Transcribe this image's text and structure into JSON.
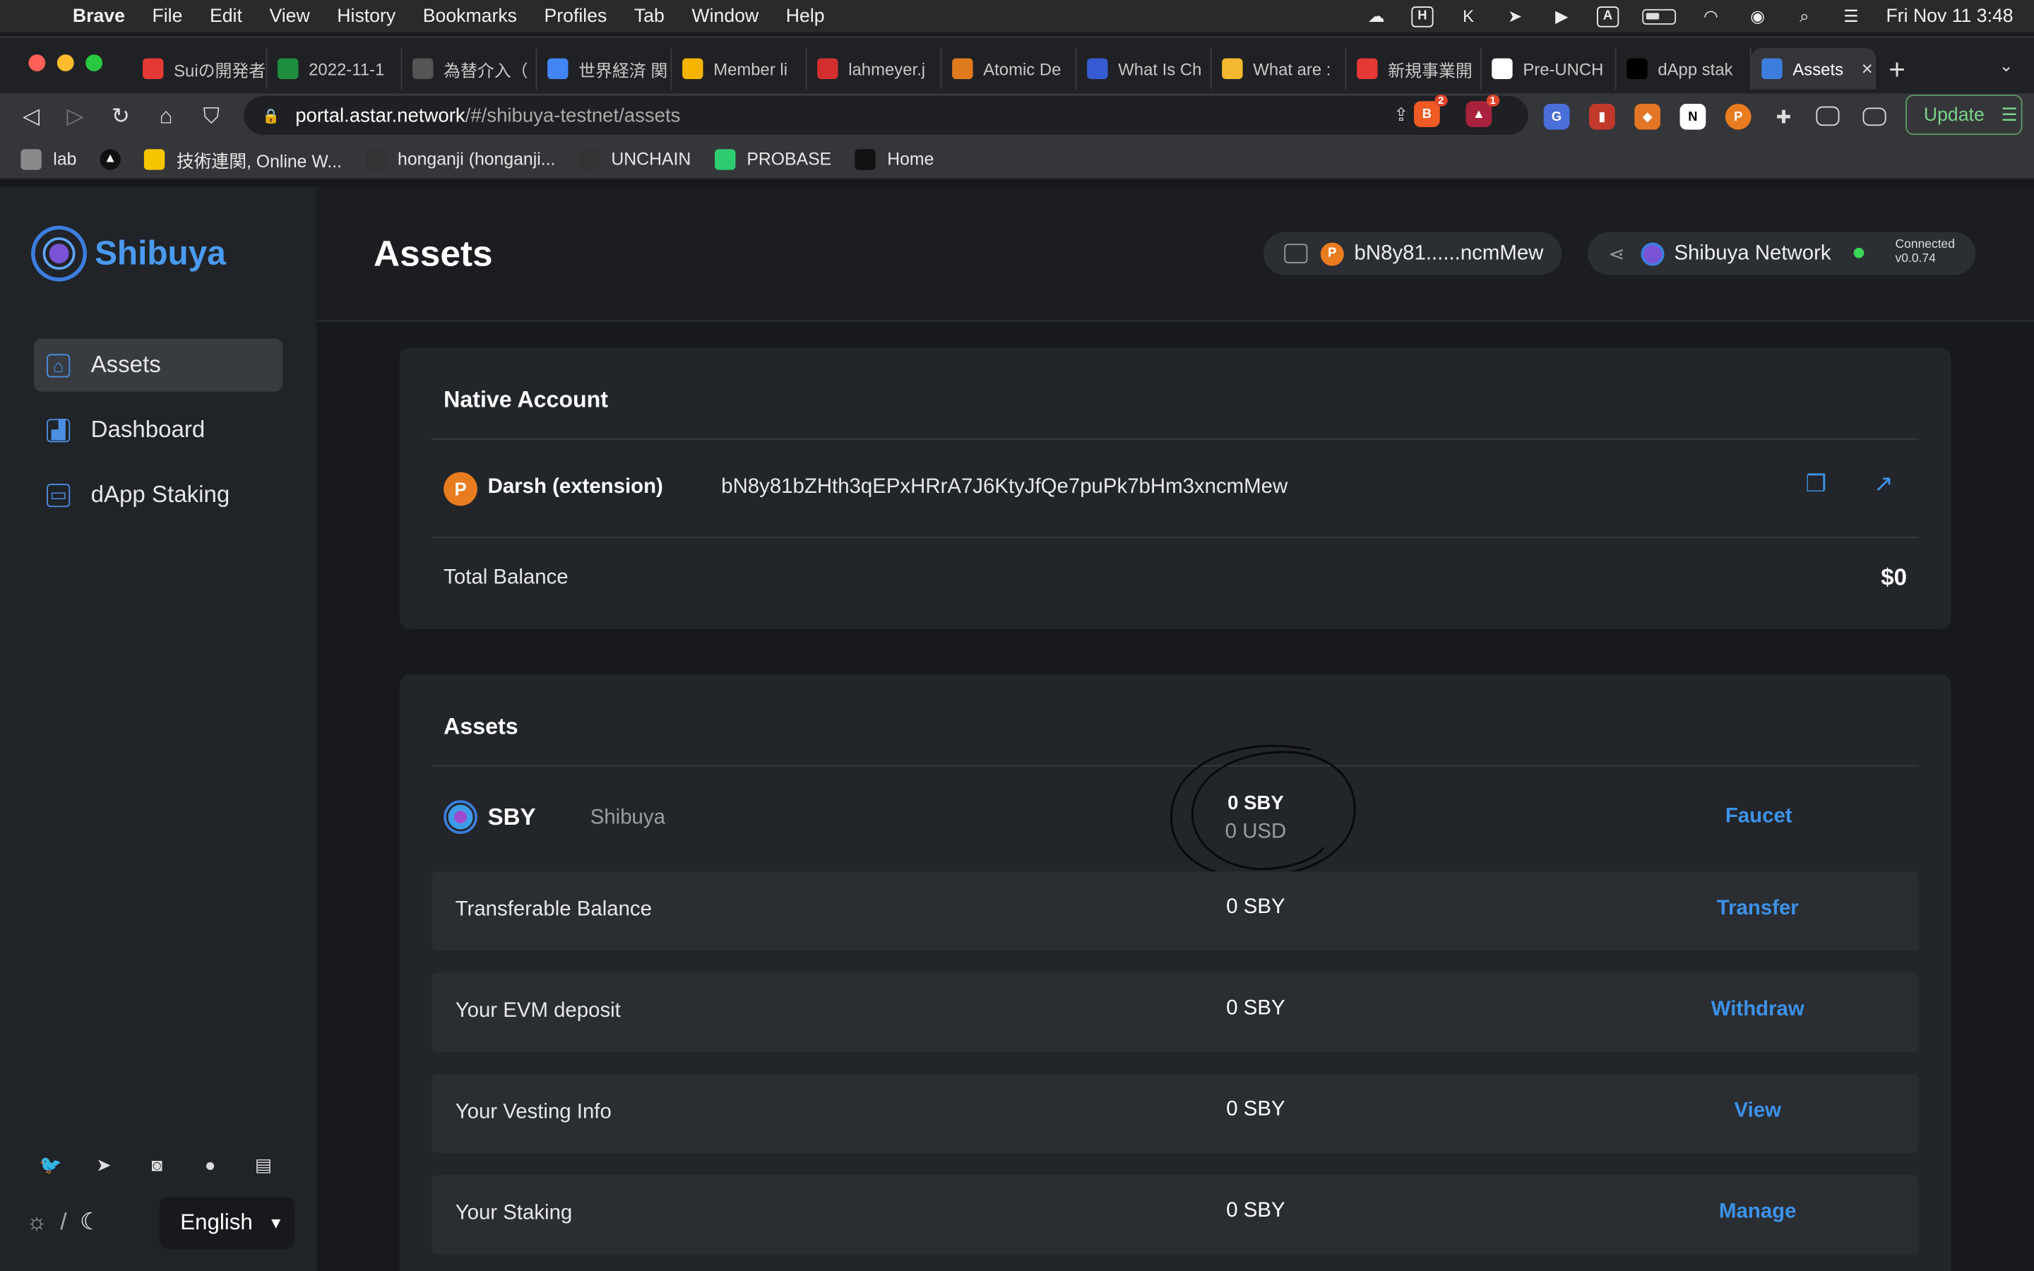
{
  "menubar": {
    "app": "Brave",
    "items": [
      "File",
      "Edit",
      "View",
      "History",
      "Bookmarks",
      "Profiles",
      "Tab",
      "Window",
      "Help"
    ],
    "clock": "Fri Nov 11  3:48"
  },
  "tabs": [
    {
      "label": "Suiの開発者",
      "icon_color": "#e53935"
    },
    {
      "label": "2022-11-1",
      "icon_color": "#1e8e3e"
    },
    {
      "label": "為替介入（",
      "icon_color": "#555555"
    },
    {
      "label": "世界経済 関",
      "icon_color": "#4285f4"
    },
    {
      "label": "Member li",
      "icon_color": "#f4b400"
    },
    {
      "label": "lahmeyer.j",
      "icon_color": "#d32f2f"
    },
    {
      "label": "Atomic De",
      "icon_color": "#e07a1f"
    },
    {
      "label": "What Is Ch",
      "icon_color": "#375bd2"
    },
    {
      "label": "What are :",
      "icon_color": "#f3ba2f"
    },
    {
      "label": "新規事業開",
      "icon_color": "#e53935"
    },
    {
      "label": "Pre-UNCH",
      "icon_color": "#ffffff"
    },
    {
      "label": "dApp stak",
      "icon_color": "#000000"
    },
    {
      "label": "Assets",
      "icon_color": "#3c7ede",
      "active": true
    }
  ],
  "address_bar": {
    "host": "portal.astar.network",
    "path": "/#/shibuya-testnet/assets"
  },
  "toolbar": {
    "update_label": "Update",
    "brave_badge": "2",
    "rewards_badge": "1"
  },
  "bookmarks": [
    {
      "label": "lab",
      "icon": "folder-icon"
    },
    {
      "label": "",
      "icon": "triangle-icon"
    },
    {
      "label": "技術連関, Online W...",
      "icon": "miro-icon"
    },
    {
      "label": "honganji (honganji...",
      "icon": "github-icon"
    },
    {
      "label": "UNCHAIN",
      "icon": "github-icon"
    },
    {
      "label": "PROBASE",
      "icon": "probase-icon"
    },
    {
      "label": "Home",
      "icon": "home-icon"
    }
  ],
  "sidebar": {
    "brand": "Shibuya",
    "items": [
      {
        "label": "Assets",
        "icon": "bank-icon",
        "active": true
      },
      {
        "label": "Dashboard",
        "icon": "chart-icon"
      },
      {
        "label": "dApp Staking",
        "icon": "bag-icon"
      }
    ],
    "language": "English"
  },
  "header": {
    "title": "Assets",
    "wallet_address": "bN8y81......ncmMew",
    "network": "Shibuya Network",
    "status": "Connected",
    "version": "v0.0.74"
  },
  "native_account": {
    "heading": "Native Account",
    "name": "Darsh (extension)",
    "address": "bN8y81bZHth3qEPxHRrA7J6KtyJfQe7puPk7bHm3xncmMew",
    "total_balance_label": "Total Balance",
    "total_balance_value": "$0"
  },
  "assets": {
    "heading": "Assets",
    "token": {
      "symbol": "SBY",
      "network": "Shibuya",
      "balance": "0 SBY",
      "balance_usd": "0 USD",
      "action": "Faucet"
    },
    "rows": [
      {
        "label": "Transferable Balance",
        "value": "0 SBY",
        "action": "Transfer"
      },
      {
        "label": "Your EVM deposit",
        "value": "0 SBY",
        "action": "Withdraw"
      },
      {
        "label": "Your Vesting Info",
        "value": "0 SBY",
        "action": "View"
      },
      {
        "label": "Your Staking",
        "value": "0 SBY",
        "action": "Manage"
      }
    ]
  },
  "colors": {
    "accent": "#3d92e8",
    "connected": "#3bd65a",
    "brand": "#4a9aef"
  }
}
